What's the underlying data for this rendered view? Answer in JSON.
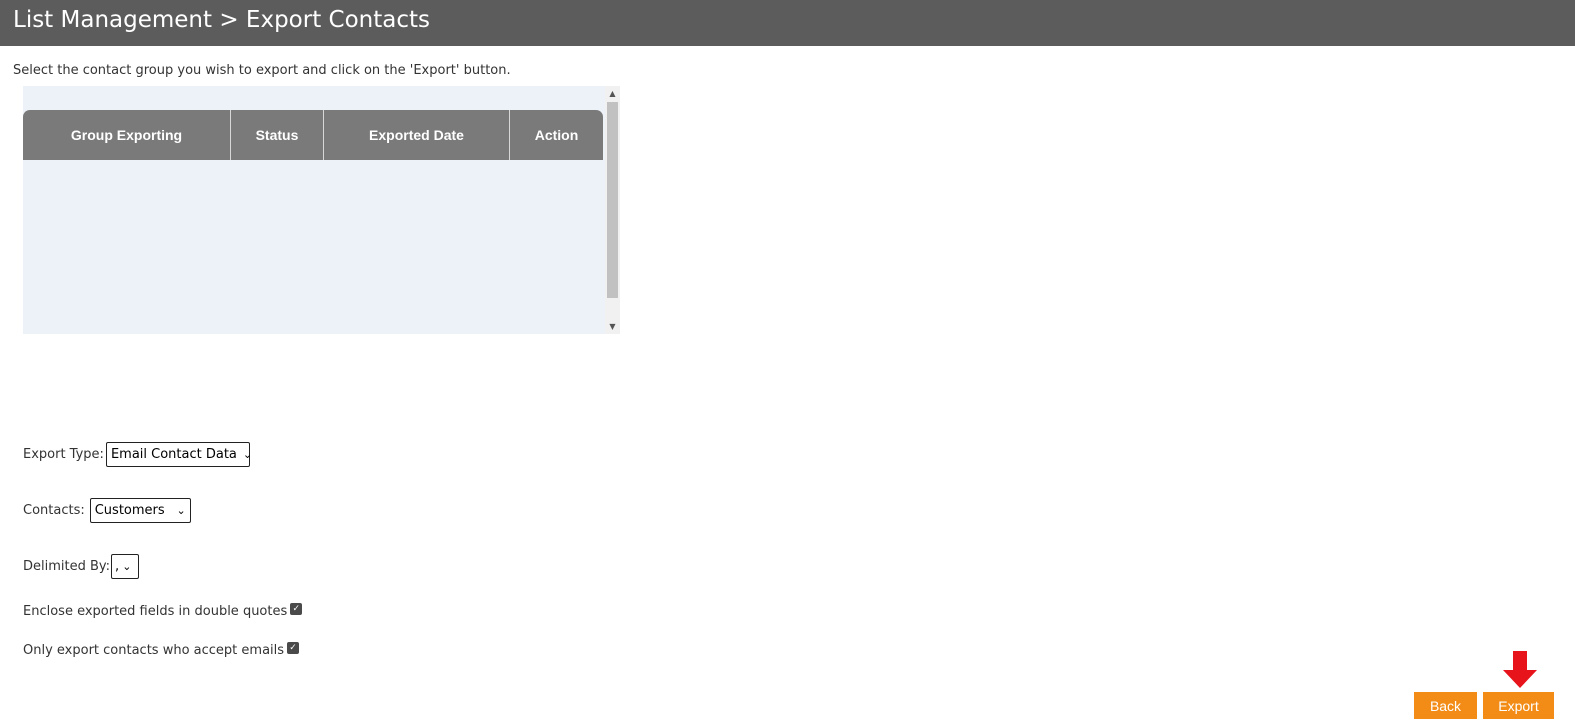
{
  "header": {
    "title": "List Management > Export Contacts"
  },
  "instruction": "Select the contact group you wish to export and click on the 'Export' button.",
  "grid": {
    "columns": [
      "Group Exporting",
      "Status",
      "Exported Date",
      "Action"
    ],
    "rows": []
  },
  "form": {
    "export_type": {
      "label": "Export Type:",
      "value": "Email Contact Data"
    },
    "contacts": {
      "label": "Contacts:",
      "value": "Customers"
    },
    "delimited_by": {
      "label": "Delimited By:",
      "value": ","
    },
    "enclose_quotes": {
      "label": "Enclose exported fields in double quotes",
      "checked": true
    },
    "accept_emails": {
      "label": "Only export contacts who accept emails",
      "checked": true
    }
  },
  "buttons": {
    "back": "Back",
    "export": "Export"
  },
  "colors": {
    "header_bg": "#5c5c5c",
    "grid_header_bg": "#7a7a7a",
    "grid_panel_bg": "#edf2f8",
    "button_bg": "#f28c17",
    "arrow": "#e8141c"
  },
  "icons": {
    "checkbox": "checkmark-icon",
    "select": "chevron-down-icon",
    "pointer": "red-down-arrow-icon"
  }
}
